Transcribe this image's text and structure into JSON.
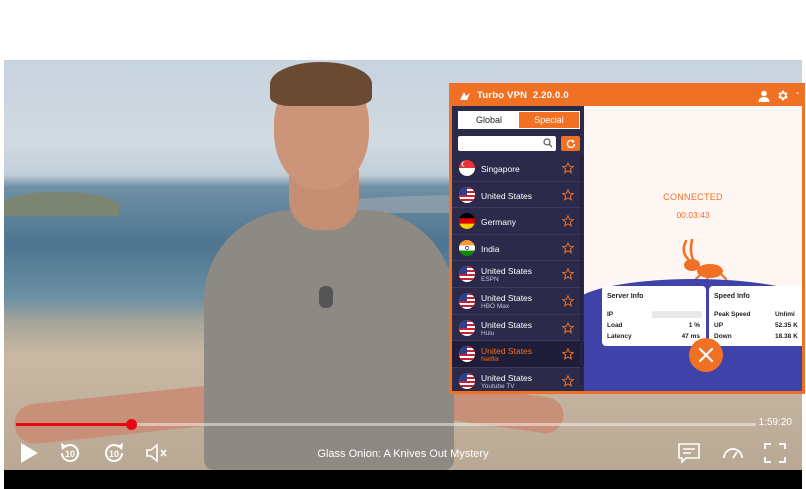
{
  "player": {
    "title": "Glass Onion: A Knives Out Mystery",
    "time_remaining": "1:59:20",
    "progress_fraction": 0.155,
    "skip_back_label": "10",
    "skip_forward_label": "10",
    "accent_color": "#e50914"
  },
  "vpn": {
    "app_name": "Turbo VPN",
    "version": "2.20.0.0",
    "dash": "-",
    "accent_color": "#f07124",
    "tabs": {
      "global": "Global",
      "special": "Special"
    },
    "search": {
      "placeholder": ""
    },
    "servers": [
      {
        "name": "Singapore",
        "sub": "",
        "flag": "sg"
      },
      {
        "name": "United States",
        "sub": "",
        "flag": "us"
      },
      {
        "name": "Germany",
        "sub": "",
        "flag": "de"
      },
      {
        "name": "India",
        "sub": "",
        "flag": "in"
      },
      {
        "name": "United States",
        "sub": "ESPN",
        "flag": "us"
      },
      {
        "name": "United States",
        "sub": "HBO Max",
        "flag": "us"
      },
      {
        "name": "United States",
        "sub": "Hulu",
        "flag": "us"
      },
      {
        "name": "United States",
        "sub": "Netflix",
        "flag": "us"
      },
      {
        "name": "United States",
        "sub": "Youtube TV",
        "flag": "us"
      }
    ],
    "active_server_index": 7,
    "status": "CONNECTED",
    "timer": "00:03:43",
    "server_info": {
      "title": "Server Info",
      "ip_label": "IP",
      "load_label": "Load",
      "load_value": "1 %",
      "latency_label": "Latency",
      "latency_value": "47 ms"
    },
    "speed_info": {
      "title": "Speed Info",
      "peak_label": "Peak Speed",
      "peak_value": "Unlimi",
      "up_label": "UP",
      "up_value": "52.35 K",
      "down_label": "Down",
      "down_value": "18.38 K"
    }
  }
}
